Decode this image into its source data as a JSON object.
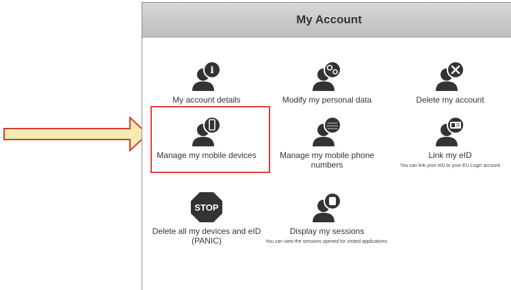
{
  "panel": {
    "title": "My Account"
  },
  "tiles": [
    {
      "label": "My account details",
      "icon": "user-info-icon"
    },
    {
      "label": "Modify my personal data",
      "icon": "user-settings-icon"
    },
    {
      "label": "Delete my account",
      "icon": "user-delete-icon"
    },
    {
      "label": "Manage my mobile devices",
      "icon": "user-mobile-icon"
    },
    {
      "label": "Manage my mobile phone numbers",
      "icon": "user-phone-number-icon"
    },
    {
      "label": "Link my eID",
      "sub": "You can link your eID to your EU Login account",
      "icon": "user-eid-card-icon"
    },
    {
      "label": "Delete all my devices and eID (PANIC)",
      "icon": "stop-icon",
      "stop_text": "STOP"
    },
    {
      "label": "Display my sessions",
      "sub": "You can view the sessions opened for visited applications.",
      "icon": "user-sessions-icon"
    }
  ],
  "annotation": {
    "arrow_color": "#f5eab0",
    "arrow_border": "#d23a2a",
    "highlight_color": "#e23a3a"
  }
}
